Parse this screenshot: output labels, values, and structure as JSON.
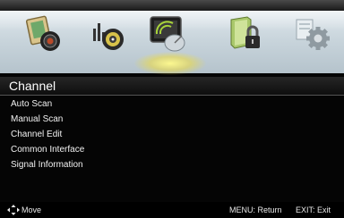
{
  "header": {
    "tabs": [
      {
        "name": "picture-icon",
        "selected": false
      },
      {
        "name": "sound-icon",
        "selected": false
      },
      {
        "name": "channel-icon",
        "selected": true
      },
      {
        "name": "lock-icon",
        "selected": false
      },
      {
        "name": "setup-icon",
        "selected": false
      }
    ]
  },
  "page": {
    "title": "Channel"
  },
  "menu": {
    "items": [
      {
        "label": "Auto Scan"
      },
      {
        "label": "Manual Scan"
      },
      {
        "label": "Channel Edit"
      },
      {
        "label": "Common Interface"
      },
      {
        "label": "Signal Information"
      }
    ]
  },
  "footer": {
    "move_label": "Move",
    "menu_hint": "MENU: Return",
    "exit_hint": "EXIT: Exit"
  },
  "colors": {
    "highlight": "#f6eb6a",
    "background": "#050505",
    "iconbar": "#c9d5dc"
  }
}
